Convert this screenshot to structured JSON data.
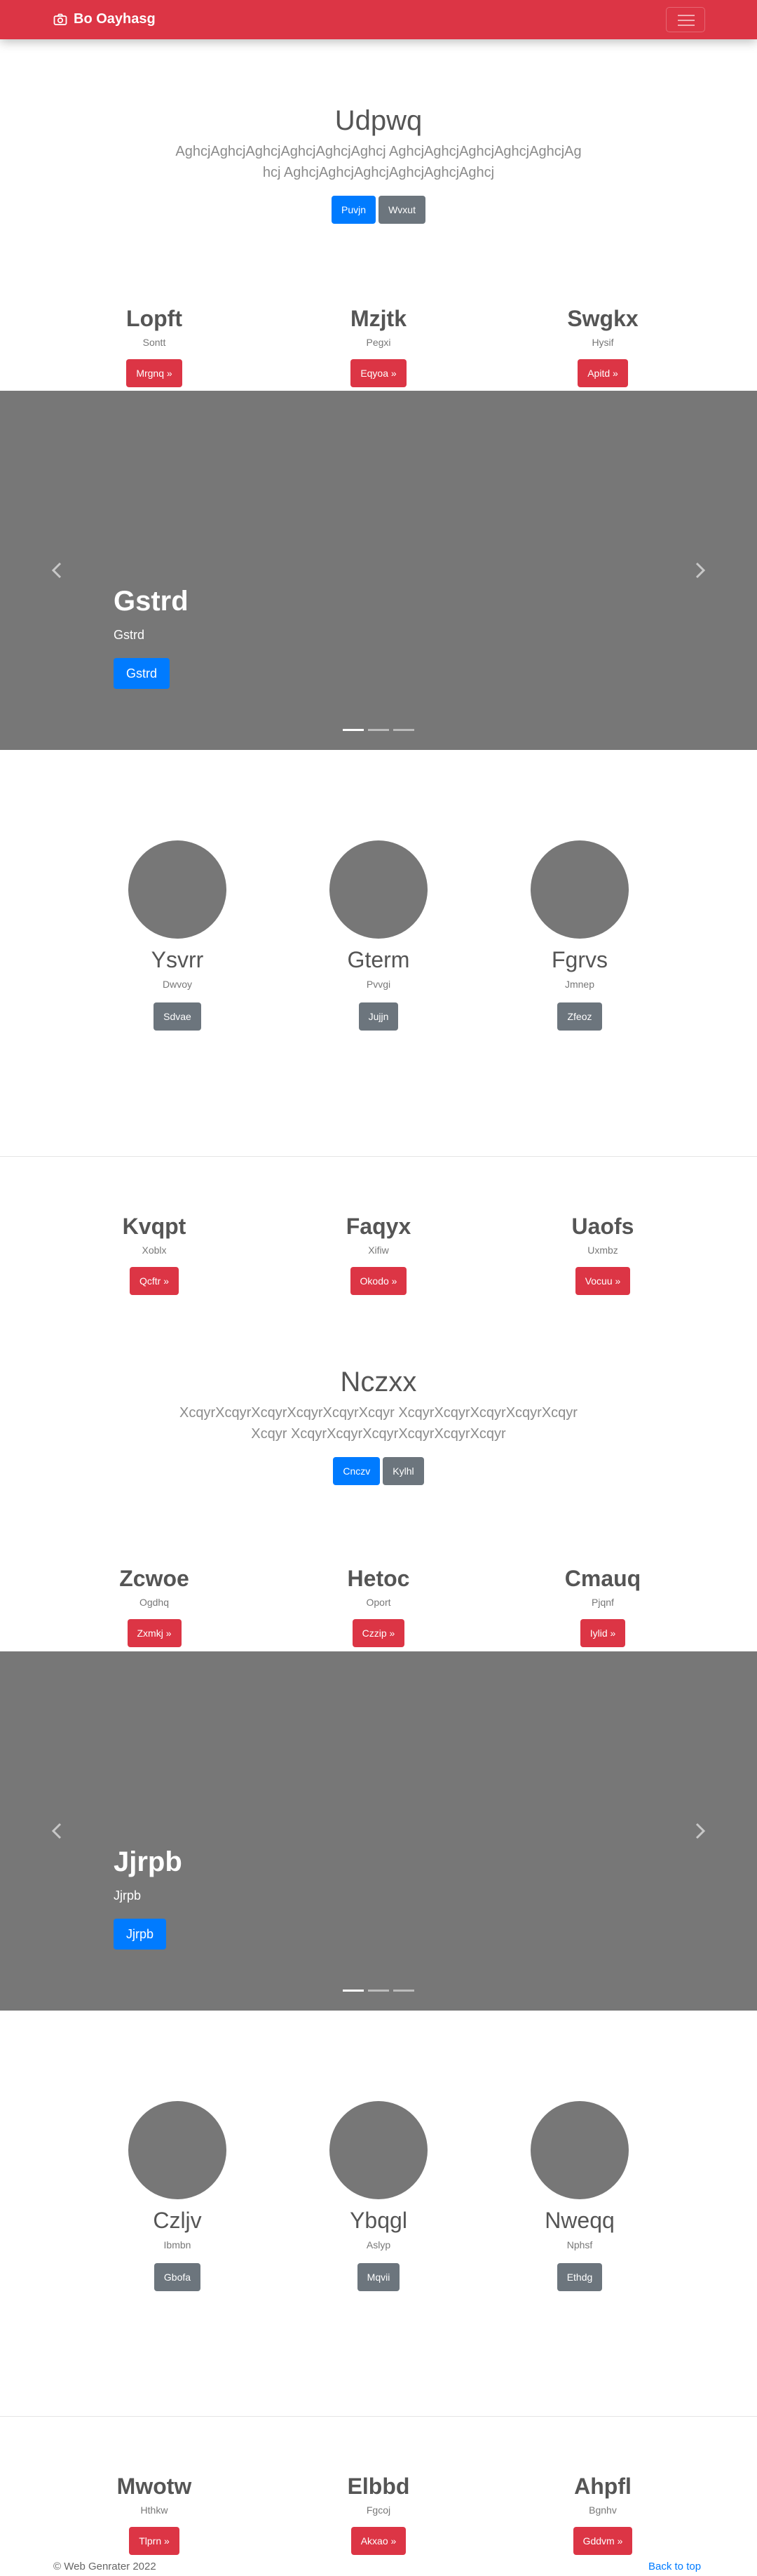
{
  "navbar": {
    "brand": "Bo Oayhasg",
    "brand_icon": "camera-icon",
    "toggler_icon": "hamburger-icon",
    "color": "#dc3545"
  },
  "jumbotron1": {
    "title": "Udpwq",
    "lead": "AghcjAghcjAghcjAghcjAghcjAghcj AghcjAghcjAghcjAghcjAghcjAghcj AghcjAghcjAghcjAghcjAghcjAghcj",
    "primary": "Puvjn",
    "secondary": "Wvxut"
  },
  "features1": [
    {
      "title": "Lopft",
      "text": "Sontt",
      "button": "Mrgnq »"
    },
    {
      "title": "Mzjtk",
      "text": "Pegxi",
      "button": "Eqyoa »"
    },
    {
      "title": "Swgkx",
      "text": "Hysif",
      "button": "Apitd »"
    }
  ],
  "carousel1": {
    "heading": "Gstrd",
    "text": "Gstrd",
    "button": "Gstrd"
  },
  "circles1": [
    {
      "title": "Ysvrr",
      "text": "Dwvoy",
      "button": "Sdvae"
    },
    {
      "title": "Gterm",
      "text": "Pvvgi",
      "button": "Jujjn"
    },
    {
      "title": "Fgrvs",
      "text": "Jmnep",
      "button": "Zfeoz"
    }
  ],
  "features2": [
    {
      "title": "Kvqpt",
      "text": "Xoblx",
      "button": "Qcftr »"
    },
    {
      "title": "Faqyx",
      "text": "Xifiw",
      "button": "Okodo »"
    },
    {
      "title": "Uaofs",
      "text": "Uxmbz",
      "button": "Vocuu »"
    }
  ],
  "jumbotron2": {
    "title": "Nczxx",
    "lead": "XcqyrXcqyrXcqyrXcqyrXcqyrXcqyr XcqyrXcqyrXcqyrXcqyrXcqyrXcqyr XcqyrXcqyrXcqyrXcqyrXcqyrXcqyr",
    "primary": "Cnczv",
    "secondary": "Kylhl"
  },
  "features3": [
    {
      "title": "Zcwoe",
      "text": "Ogdhq",
      "button": "Zxmkj »"
    },
    {
      "title": "Hetoc",
      "text": "Oport",
      "button": "Czzip »"
    },
    {
      "title": "Cmauq",
      "text": "Pjqnf",
      "button": "Iylid »"
    }
  ],
  "carousel2": {
    "heading": "Jjrpb",
    "text": "Jjrpb",
    "button": "Jjrpb"
  },
  "circles2": [
    {
      "title": "Czljv",
      "text": "Ibmbn",
      "button": "Gbofa"
    },
    {
      "title": "Ybqgl",
      "text": "Aslyp",
      "button": "Mqvii"
    },
    {
      "title": "Nweqq",
      "text": "Nphsf",
      "button": "Ethdg"
    }
  ],
  "features4": [
    {
      "title": "Mwotw",
      "text": "Hthkw",
      "button": "Tlprn »"
    },
    {
      "title": "Elbbd",
      "text": "Fgcoj",
      "button": "Akxao »"
    },
    {
      "title": "Ahpfl",
      "text": "Bgnhv",
      "button": "Gddvm »"
    }
  ],
  "footer": {
    "copyright": "© Web Genrater 2022",
    "back_to_top": "Back to top"
  }
}
